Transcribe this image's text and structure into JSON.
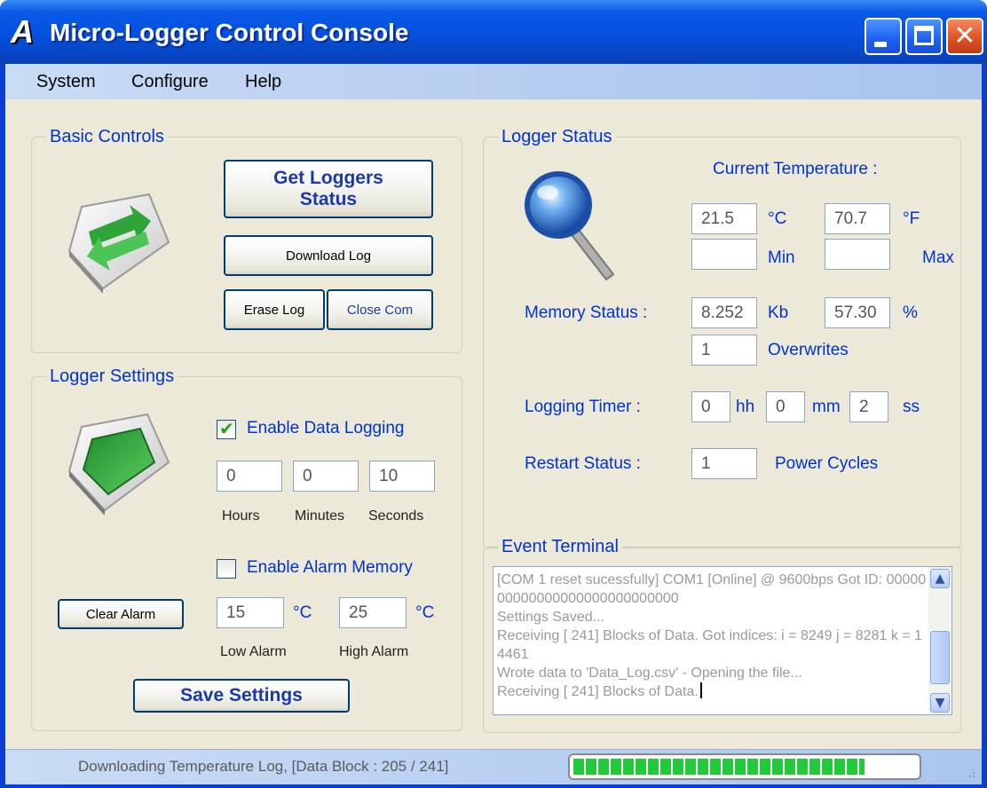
{
  "window": {
    "title": "Micro-Logger Control Console",
    "app_icon_letter": "A"
  },
  "menu": [
    "System",
    "Configure",
    "Help"
  ],
  "basic_controls": {
    "title": "Basic Controls",
    "get_status_label": "Get Loggers Status",
    "download_label": "Download Log",
    "erase_label": "Erase Log",
    "close_com_label": "Close Com"
  },
  "logger_settings": {
    "title": "Logger Settings",
    "enable_logging_label": "Enable Data Logging",
    "enable_logging_checked": true,
    "hours": "0",
    "minutes": "0",
    "seconds": "10",
    "hours_label": "Hours",
    "minutes_label": "Minutes",
    "seconds_label": "Seconds",
    "enable_alarm_label": "Enable Alarm Memory",
    "enable_alarm_checked": false,
    "clear_alarm_label": "Clear Alarm",
    "low_alarm": "15",
    "high_alarm": "25",
    "unit_c": "°C",
    "low_alarm_label": "Low Alarm",
    "high_alarm_label": "High Alarm",
    "save_label": "Save Settings"
  },
  "logger_status": {
    "title": "Logger Status",
    "current_temp_label": "Current Temperature :",
    "temp_c": "21.5",
    "unit_c": "°C",
    "temp_f": "70.7",
    "unit_f": "°F",
    "min_value": "",
    "min_label": "Min",
    "max_value": "",
    "max_label": "Max",
    "memory_label": "Memory Status :",
    "memory_kb": "8.252",
    "kb_label": "Kb",
    "memory_pct": "57.30",
    "pct_label": "%",
    "overwrites": "1",
    "overwrites_label": "Overwrites",
    "timer_label": "Logging Timer :",
    "timer_hh": "0",
    "hh_label": "hh",
    "timer_mm": "0",
    "mm_label": "mm",
    "timer_ss": "2",
    "ss_label": "ss",
    "restart_label": "Restart Status :",
    "restart_value": "1",
    "power_cycles_label": "Power Cycles"
  },
  "event_terminal": {
    "title": "Event Terminal",
    "lines": [
      "[COM 1 reset sucessfully] COM1 [Online] @ 9600bps Got ID: 0000000000000000000000000000",
      "Settings Saved...",
      "Receiving [ 241] Blocks of Data. Got indices: i = 8249 j = 8281 k = 14461",
      "Wrote data to 'Data_Log.csv' - Opening the file...",
      "Receiving [ 241] Blocks of Data."
    ]
  },
  "status_bar": {
    "text": "Downloading  Temperature Log, [Data Block :  205 /  241]",
    "progress_fraction": 0.85
  },
  "colors": {
    "label_blue": "#0033cc",
    "title_blue": "#0550dc",
    "progress_green": "#22c93a"
  }
}
